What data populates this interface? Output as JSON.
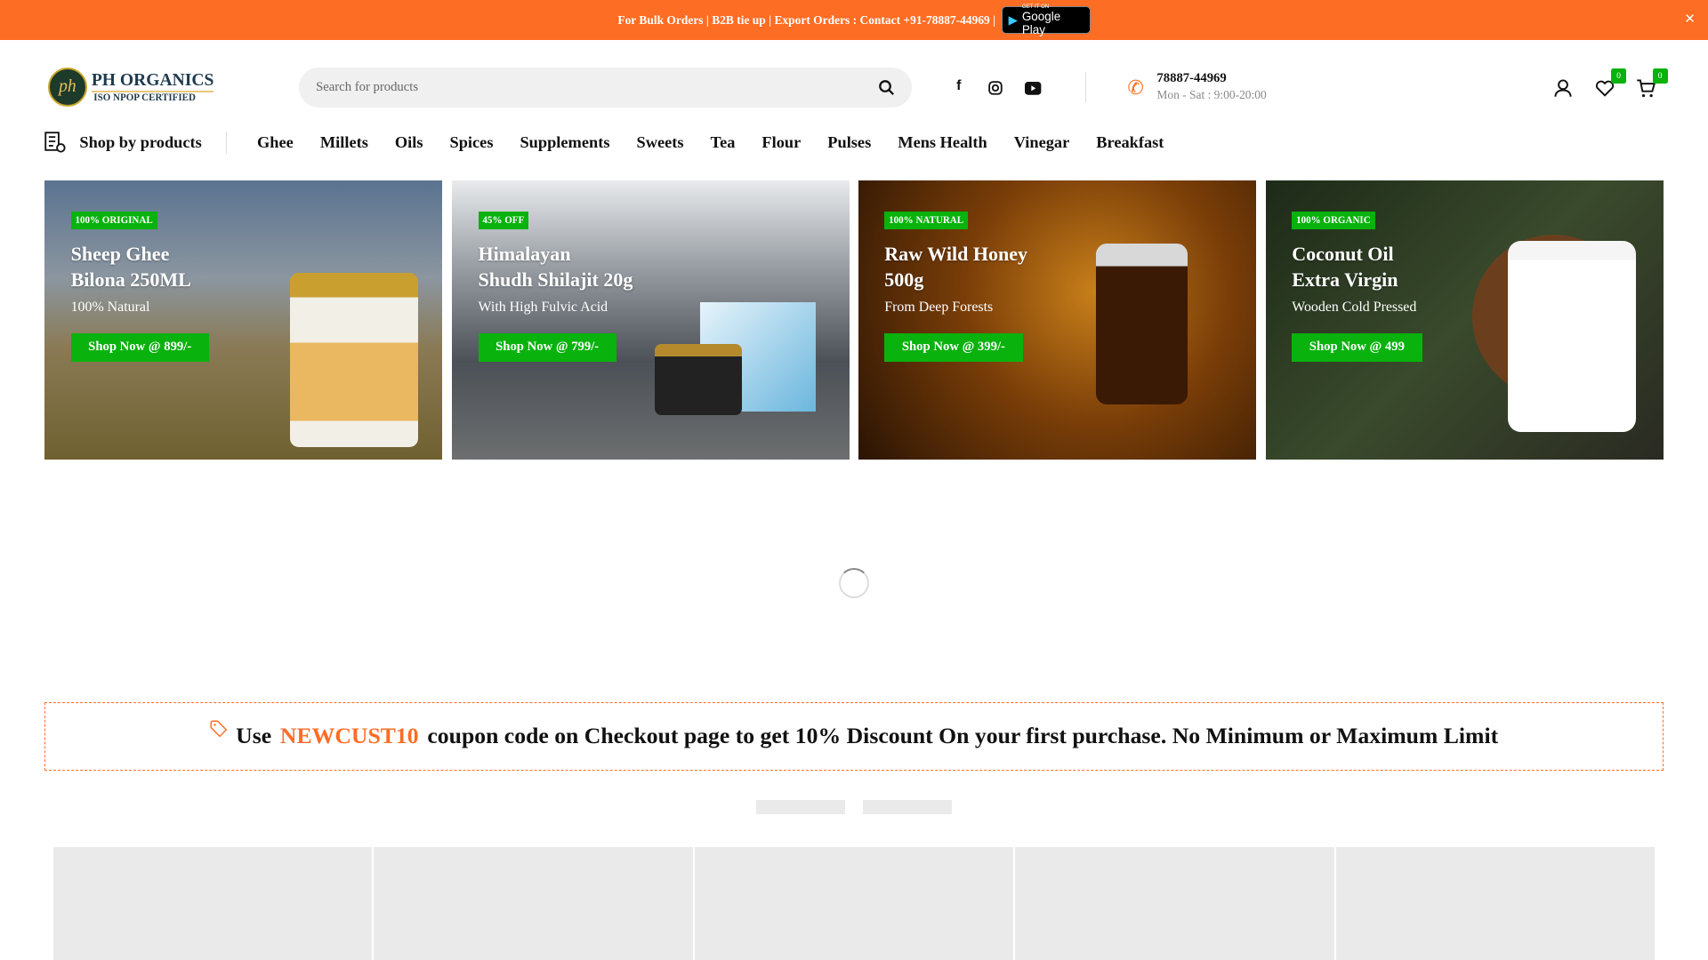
{
  "topbar": {
    "message": "For Bulk Orders | B2B tie up | Export Orders : Contact +91-78887-44969 |",
    "gplay_small": "GET IT ON",
    "gplay": "Google Play",
    "close": "×"
  },
  "header": {
    "logo_title": "PH ORGANICS",
    "logo_sub": "ISO NPOP CERTIFIED",
    "logo_mark": "ph",
    "search_placeholder": "Search for products",
    "phone": "78887-44969",
    "hours": "Mon - Sat : 9:00-20:00",
    "wishlist_count": "0",
    "cart_count": "0"
  },
  "nav": {
    "shop_by": "Shop by products",
    "items": [
      "Ghee",
      "Millets",
      "Oils",
      "Spices",
      "Supplements",
      "Sweets",
      "Tea",
      "Flour",
      "Pulses",
      "Mens Health",
      "Vinegar",
      "Breakfast"
    ]
  },
  "banners": [
    {
      "tag": "100% ORIGINAL",
      "title1": "Sheep Ghee",
      "title2": "Bilona 250ML",
      "sub": "100% Natural",
      "button": "Shop Now @ 899/-"
    },
    {
      "tag": "45% OFF",
      "title1": "Himalayan",
      "title2": "Shudh Shilajit 20g",
      "sub": "With High Fulvic Acid",
      "button": "Shop Now @ 799/-"
    },
    {
      "tag": "100% NATURAL",
      "title1": "Raw Wild Honey",
      "title2": "500g",
      "sub": "From Deep Forests",
      "button": "Shop Now @ 399/-"
    },
    {
      "tag": "100% ORGANIC",
      "title1": "Coconut Oil",
      "title2": "Extra Virgin",
      "sub": "Wooden Cold Pressed",
      "button": "Shop Now @ 499"
    }
  ],
  "coupon": {
    "pre": "Use",
    "code": "NEWCUST10",
    "post": "coupon code on Checkout page to get 10% Discount On your first purchase. No Minimum or Maximum Limit"
  },
  "colors": {
    "accent": "#fd6d24",
    "green": "#09b20d"
  }
}
